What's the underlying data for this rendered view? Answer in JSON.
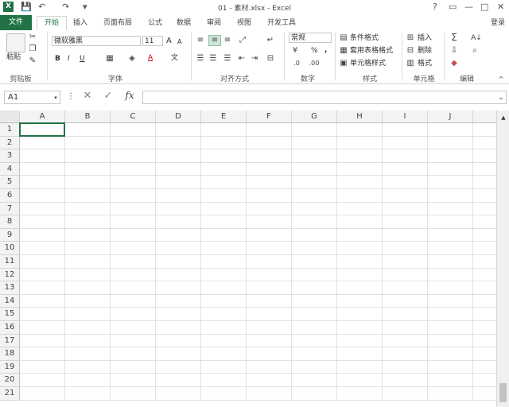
{
  "window": {
    "title": "01 - 素材.xlsx - Excel",
    "help": "?",
    "restore": "▭",
    "minimize": "—",
    "maximize": "□",
    "close": "✕",
    "login": "登录"
  },
  "quick_access": {
    "save": "💾",
    "undo": "↶",
    "redo": "↷",
    "customize": "▾"
  },
  "tabs": [
    "文件",
    "开始",
    "插入",
    "页面布局",
    "公式",
    "数据",
    "审阅",
    "视图",
    "开发工具"
  ],
  "ribbon": {
    "clipboard": {
      "paste": "粘贴",
      "label": "剪贴板"
    },
    "font": {
      "name": "微软雅黑",
      "size": "11",
      "label": "字体",
      "bold": "B",
      "italic": "I",
      "underline": "U",
      "grow": "A",
      "shrink": "A",
      "wen": "文"
    },
    "alignment": {
      "label": "对齐方式"
    },
    "number": {
      "format": "常规",
      "percent": "%",
      "comma": ",",
      "label": "数字"
    },
    "styles": {
      "conditional": "条件格式",
      "table": "套用表格格式",
      "cell": "单元格样式",
      "label": "样式"
    },
    "cells": {
      "insert": "插入",
      "delete": "删除",
      "format": "格式",
      "label": "单元格"
    },
    "editing": {
      "label": "编辑"
    }
  },
  "formula_bar": {
    "name_box": "A1",
    "cancel": "✕",
    "enter": "✓",
    "fx": "fx",
    "value": ""
  },
  "sheet": {
    "columns": [
      "A",
      "B",
      "C",
      "D",
      "E",
      "F",
      "G",
      "H",
      "I",
      "J"
    ],
    "rows": [
      "1",
      "2",
      "3",
      "4",
      "5",
      "6",
      "7",
      "8",
      "9",
      "10",
      "11",
      "12",
      "13",
      "14",
      "15",
      "16",
      "17",
      "18",
      "19",
      "20",
      "21"
    ],
    "selected_cell": "A1"
  },
  "colors": {
    "accent": "#217346"
  }
}
